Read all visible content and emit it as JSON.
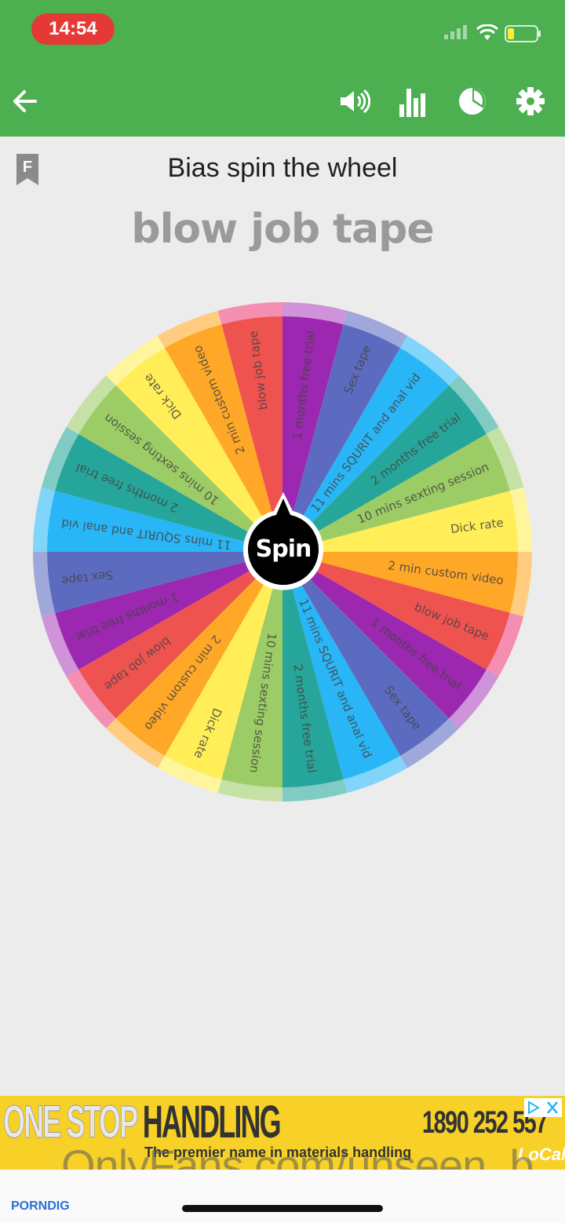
{
  "status_bar": {
    "time": "14:54",
    "time_pill_color": "#e53935"
  },
  "toolbar": {
    "bg_color": "#4caf50",
    "icons": [
      "back-arrow-icon",
      "volume-icon",
      "bar-chart-icon",
      "pie-chart-icon",
      "gear-icon"
    ]
  },
  "page": {
    "bookmark_letter": "F",
    "title": "Bias spin the wheel",
    "result": "blow job tape"
  },
  "wheel": {
    "center_label": "Spin",
    "slices": [
      {
        "label": "blow job tape",
        "color": "#ef5350",
        "rim": "#f48fb1"
      },
      {
        "label": "1 months free trial",
        "color": "#9c27b0",
        "rim": "#ce93d8"
      },
      {
        "label": "Sex tape",
        "color": "#5c6bc0",
        "rim": "#9fa8da"
      },
      {
        "label": "11 mins SQURIT and anal vid",
        "color": "#29b6f6",
        "rim": "#81d4fa"
      },
      {
        "label": "2 months free trial",
        "color": "#26a69a",
        "rim": "#80cbc4"
      },
      {
        "label": "10 mins sexting session",
        "color": "#9ccc65",
        "rim": "#c5e1a5"
      },
      {
        "label": "Dick rate",
        "color": "#ffee58",
        "rim": "#fff59d"
      },
      {
        "label": "2 min custom video",
        "color": "#ffa726",
        "rim": "#ffcc80"
      },
      {
        "label": "blow job tape",
        "color": "#ef5350",
        "rim": "#f48fb1"
      },
      {
        "label": "1 months free trial",
        "color": "#9c27b0",
        "rim": "#ce93d8"
      },
      {
        "label": "Sex tape",
        "color": "#5c6bc0",
        "rim": "#9fa8da"
      },
      {
        "label": "11 mins SQURIT and anal vid",
        "color": "#29b6f6",
        "rim": "#81d4fa"
      },
      {
        "label": "2 months free trial",
        "color": "#26a69a",
        "rim": "#80cbc4"
      },
      {
        "label": "10 mins sexting session",
        "color": "#9ccc65",
        "rim": "#c5e1a5"
      },
      {
        "label": "Dick rate",
        "color": "#ffee58",
        "rim": "#fff59d"
      },
      {
        "label": "2 min custom video",
        "color": "#ffa726",
        "rim": "#ffcc80"
      },
      {
        "label": "blow job tape",
        "color": "#ef5350",
        "rim": "#f48fb1"
      },
      {
        "label": "1 months free trial",
        "color": "#9c27b0",
        "rim": "#ce93d8"
      },
      {
        "label": "Sex tape",
        "color": "#5c6bc0",
        "rim": "#9fa8da"
      },
      {
        "label": "11 mins SQURIT and anal vid",
        "color": "#29b6f6",
        "rim": "#81d4fa"
      },
      {
        "label": "2 months free trial",
        "color": "#26a69a",
        "rim": "#80cbc4"
      },
      {
        "label": "10 mins sexting session",
        "color": "#9ccc65",
        "rim": "#c5e1a5"
      },
      {
        "label": "Dick rate",
        "color": "#ffee58",
        "rim": "#fff59d"
      },
      {
        "label": "2 min custom video",
        "color": "#ffa726",
        "rim": "#ffcc80"
      }
    ]
  },
  "ad": {
    "headline_part1": "ONE STOP",
    "headline_part2": "HANDLING",
    "phone": "1890 252 557",
    "subtitle": "The premier name in materials handling",
    "logo": "LoCall",
    "bg_color": "#f7d128"
  },
  "watermark": "OnlyFans.com/unseen_b",
  "footer_logo": "PORNDIG"
}
